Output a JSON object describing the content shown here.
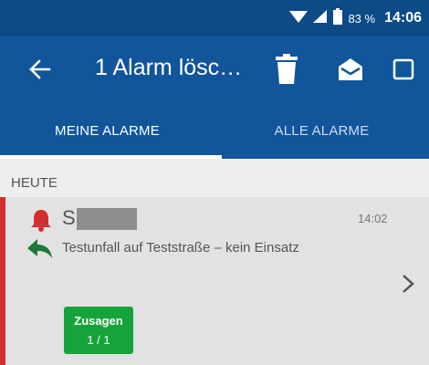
{
  "status_bar": {
    "battery_percent": "83 %",
    "time": "14:06",
    "icons": [
      "wifi-icon",
      "signal-icon",
      "battery-icon"
    ]
  },
  "toolbar": {
    "title": "1 Alarm lösc…",
    "icons": [
      "back-arrow-icon",
      "trash-icon",
      "mail-open-icon",
      "checkbox-icon"
    ]
  },
  "tabs": [
    {
      "label": "MEINE ALARME",
      "active": true
    },
    {
      "label": "ALLE ALARME",
      "active": false
    }
  ],
  "section": {
    "header": "HEUTE"
  },
  "alarm": {
    "sender_initial": "S",
    "time": "14:02",
    "text": "Testunfall auf Teststraße – kein Einsatz",
    "response_button": {
      "label": "Zusagen",
      "count": "1 / 1"
    },
    "icons": [
      "bell-icon",
      "reply-icon",
      "chevron-right-icon"
    ]
  },
  "colors": {
    "status_bar": "#0d4a86",
    "toolbar": "#11559b",
    "alarm_strip": "#d32f2f",
    "bell": "#d32f2f",
    "reply": "#1f7a3a",
    "zusagen": "#17a33b"
  }
}
